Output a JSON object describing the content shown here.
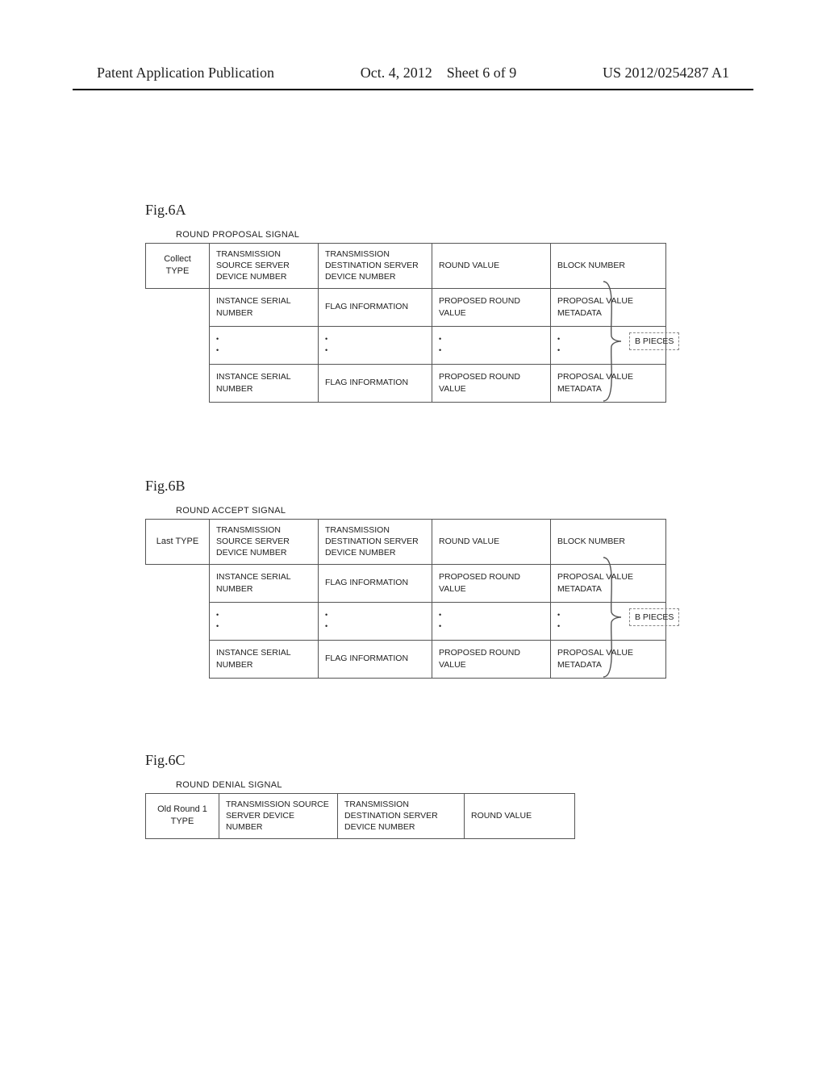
{
  "header": {
    "left": "Patent Application Publication",
    "date": "Oct. 4, 2012",
    "sheet": "Sheet 6 of 9",
    "pubno": "US 2012/0254287 A1"
  },
  "fig6a": {
    "label": "Fig.6A",
    "caption": "ROUND PROPOSAL SIGNAL",
    "type": "Collect TYPE",
    "row1": {
      "c1": "TRANSMISSION SOURCE SERVER DEVICE NUMBER",
      "c2": "TRANSMISSION DESTINATION SERVER DEVICE NUMBER",
      "c3": "ROUND VALUE",
      "c4": "BLOCK NUMBER"
    },
    "row2": {
      "c1": "INSTANCE SERIAL NUMBER",
      "c2": "FLAG INFORMATION",
      "c3": "PROPOSED ROUND VALUE",
      "c4": "PROPOSAL VALUE METADATA"
    },
    "row4": {
      "c1": "INSTANCE SERIAL NUMBER",
      "c2": "FLAG INFORMATION",
      "c3": "PROPOSED ROUND VALUE",
      "c4": "PROPOSAL VALUE METADATA"
    },
    "pieces": "B PIECES"
  },
  "fig6b": {
    "label": "Fig.6B",
    "caption": "ROUND ACCEPT SIGNAL",
    "type": "Last TYPE",
    "row1": {
      "c1": "TRANSMISSION SOURCE SERVER DEVICE NUMBER",
      "c2": "TRANSMISSION DESTINATION SERVER DEVICE NUMBER",
      "c3": "ROUND VALUE",
      "c4": "BLOCK NUMBER"
    },
    "row2": {
      "c1": "INSTANCE SERIAL NUMBER",
      "c2": "FLAG INFORMATION",
      "c3": "PROPOSED ROUND VALUE",
      "c4": "PROPOSAL VALUE METADATA"
    },
    "row4": {
      "c1": "INSTANCE SERIAL NUMBER",
      "c2": "FLAG INFORMATION",
      "c3": "PROPOSED ROUND VALUE",
      "c4": "PROPOSAL VALUE METADATA"
    },
    "pieces": "B PIECES"
  },
  "fig6c": {
    "label": "Fig.6C",
    "caption": "ROUND DENIAL SIGNAL",
    "type": "Old Round 1 TYPE",
    "row1": {
      "c1": "TRANSMISSION SOURCE SERVER DEVICE NUMBER",
      "c2": "TRANSMISSION DESTINATION SERVER DEVICE NUMBER",
      "c3": "ROUND VALUE"
    }
  }
}
